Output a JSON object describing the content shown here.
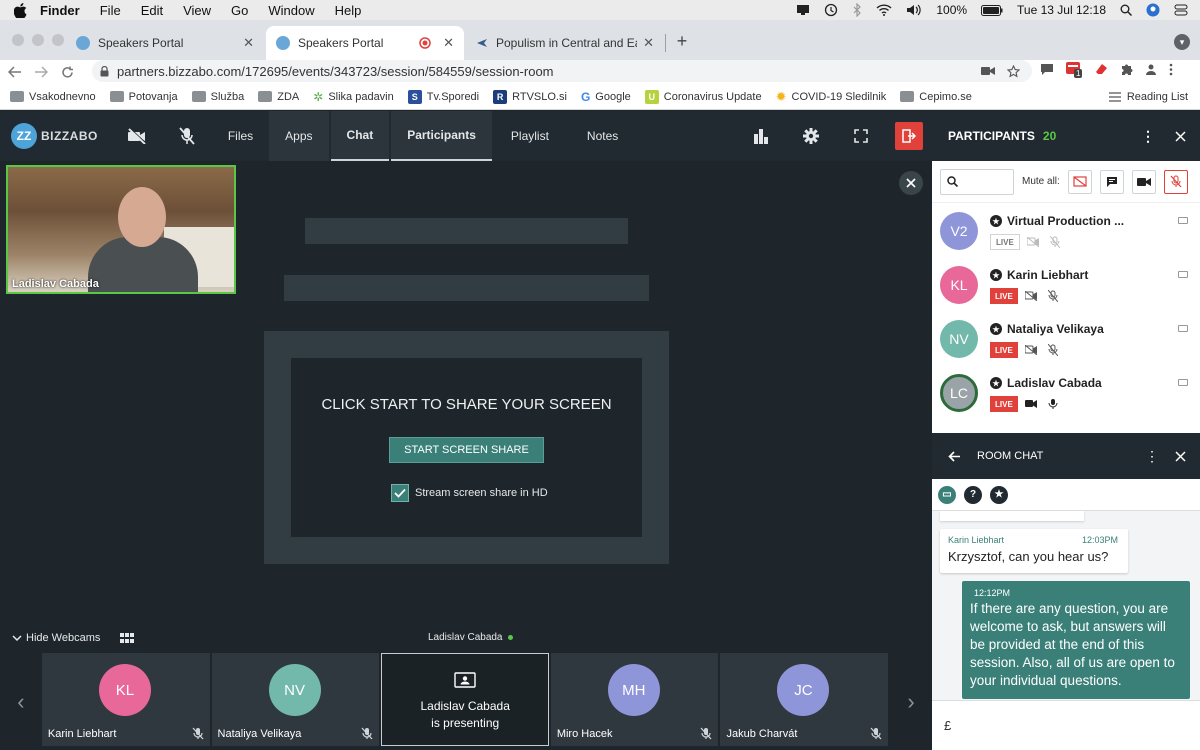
{
  "menubar": {
    "app": "Finder",
    "items": [
      "File",
      "Edit",
      "View",
      "Go",
      "Window",
      "Help"
    ],
    "battery": "100%",
    "datetime": "Tue 13 Jul  12:18"
  },
  "browser": {
    "tabs": [
      {
        "title": "Speakers Portal"
      },
      {
        "title": "Speakers Portal"
      },
      {
        "title": "Populism in Central and Eastern"
      }
    ],
    "url": "partners.bizzabo.com/172695/events/343723/session/584559/session-room",
    "extension_badge": "1",
    "bookmarks": [
      {
        "label": "Vsakodnevno",
        "kind": "folder"
      },
      {
        "label": "Potovanja",
        "kind": "folder"
      },
      {
        "label": "Služba",
        "kind": "folder"
      },
      {
        "label": "ZDA",
        "kind": "folder"
      },
      {
        "label": "Slika padavin",
        "kind": "site"
      },
      {
        "label": "Tv.Sporedi",
        "kind": "site"
      },
      {
        "label": "RTVSLO.si",
        "kind": "site"
      },
      {
        "label": "Google",
        "kind": "site"
      },
      {
        "label": "Coronavirus Update",
        "kind": "site"
      },
      {
        "label": "COVID-19 Sledilnik",
        "kind": "site"
      },
      {
        "label": "Cepimo.se",
        "kind": "folder"
      }
    ],
    "reading_list": "Reading List"
  },
  "app": {
    "logo_text": "BIZZABO",
    "nav": {
      "files": "Files",
      "apps": "Apps",
      "chat": "Chat",
      "participants": "Participants",
      "playlist": "Playlist",
      "notes": "Notes"
    }
  },
  "stage": {
    "self_cam_name": "Ladislav Cabada",
    "share_title": "CLICK START TO SHARE YOUR SCREEN",
    "share_button": "START SCREEN SHARE",
    "hd_label": "Stream screen share in HD",
    "hd_checked": true
  },
  "webcams": {
    "hide_label": "Hide Webcams",
    "presenter": "Ladislav Cabada",
    "tiles": [
      {
        "initials": "KL",
        "name": "Karin Liebhart",
        "color": "#e8689a"
      },
      {
        "initials": "NV",
        "name": "Nataliya Velikaya",
        "color": "#72b8ab"
      },
      {
        "presenting": true,
        "line1": "Ladislav Cabada",
        "line2": "is presenting"
      },
      {
        "initials": "MH",
        "name": "Miro Hacek",
        "color": "#8e95d8"
      },
      {
        "initials": "JC",
        "name": "Jakub Charvát",
        "color": "#8e95d8"
      }
    ]
  },
  "participants": {
    "title": "PARTICIPANTS",
    "count": "20",
    "mute_all": "Mute all:",
    "list": [
      {
        "initials": "V2",
        "name": "Virtual Production ...",
        "live": false,
        "color": "#8e95d8"
      },
      {
        "initials": "KL",
        "name": "Karin Liebhart",
        "live": true,
        "color": "#e8689a"
      },
      {
        "initials": "NV",
        "name": "Nataliya Velikaya",
        "live": true,
        "color": "#72b8ab"
      },
      {
        "initials": "LC",
        "name": "Ladislav Cabada",
        "live": true,
        "color": "#9aa3a8"
      }
    ],
    "live_label": "LIVE"
  },
  "chat": {
    "title": "ROOM CHAT",
    "messages": [
      {
        "author": "Karin Liebhart",
        "time": "12:03PM",
        "text": "Krzysztof, can you hear us?"
      },
      {
        "time": "12:12PM",
        "text": "If there are any question, you are welcome to ask, but answers will be provided at the end of this session. Also, all of us are open to your individual questions."
      }
    ],
    "input_value": "£"
  }
}
